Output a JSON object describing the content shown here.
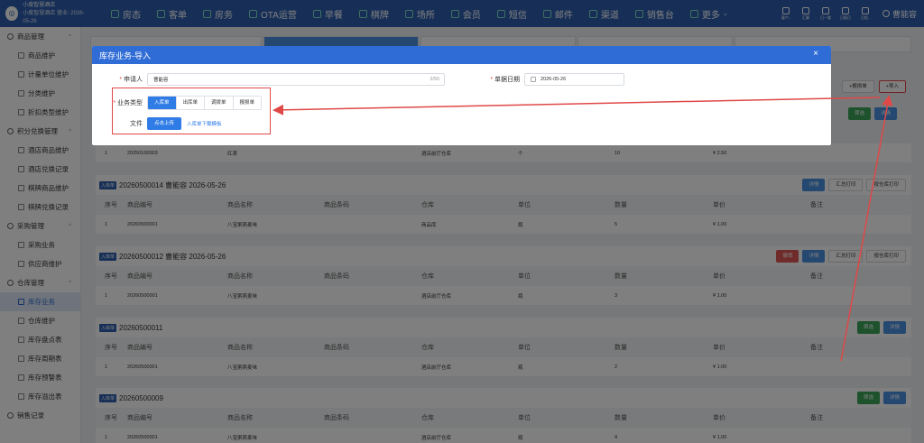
{
  "app": {
    "name": "小度智慧酒店",
    "subtitle": "小度智慧酒店 营业: 2026-05-26"
  },
  "nav": [
    "房态",
    "客单",
    "房务",
    "OTA运营",
    "早餐",
    "棋牌",
    "场所",
    "会员",
    "短信",
    "邮件",
    "渠道",
    "销售台",
    "更多"
  ],
  "nav_more_caret": "⌄",
  "tools": [
    "客户..",
    "汇算",
    "日一看",
    "日报日",
    "日程.."
  ],
  "user": "曹能容",
  "sidebar": [
    {
      "label": "商品管理",
      "type": "group",
      "caret": "^"
    },
    {
      "label": "商品维护",
      "type": "item"
    },
    {
      "label": "计量单位维护",
      "type": "item"
    },
    {
      "label": "分类维护",
      "type": "item"
    },
    {
      "label": "折扣类型维护",
      "type": "item"
    },
    {
      "label": "积分兑换管理",
      "type": "group",
      "caret": "^"
    },
    {
      "label": "酒店商品维护",
      "type": "item"
    },
    {
      "label": "酒店兑换记录",
      "type": "item"
    },
    {
      "label": "棋牌商品维护",
      "type": "item"
    },
    {
      "label": "棋牌兑换记录",
      "type": "item"
    },
    {
      "label": "采购管理",
      "type": "group",
      "caret": "^"
    },
    {
      "label": "采购业务",
      "type": "item"
    },
    {
      "label": "供应商维护",
      "type": "item"
    },
    {
      "label": "仓库管理",
      "type": "group",
      "caret": "^"
    },
    {
      "label": "库存业务",
      "type": "item",
      "active": true
    },
    {
      "label": "仓库维护",
      "type": "item"
    },
    {
      "label": "库存盘点表",
      "type": "item"
    },
    {
      "label": "库存周期表",
      "type": "item"
    },
    {
      "label": "库存预警表",
      "type": "item"
    },
    {
      "label": "库存溢出表",
      "type": "item"
    },
    {
      "label": "销售记录",
      "type": "group"
    }
  ],
  "toolbar": {
    "btn1": "报损单",
    "btn2": "导入"
  },
  "filter": {
    "btn1": "筛选",
    "btn2": "详情"
  },
  "columns": [
    "序号",
    "商品编号",
    "商品名称",
    "商品条码",
    "仓库",
    "单位",
    "数量",
    "单价",
    "备注"
  ],
  "partial_row": {
    "no": "1",
    "code": "20250100003",
    "name": "红茶",
    "barcode": "",
    "warehouse": "酒店前厅仓库",
    "unit": "个",
    "qty": "10",
    "price": "¥ 2.50",
    "note": ""
  },
  "records": [
    {
      "tag": "入库单",
      "title": "20260500014 曹能容 2026-05-26",
      "buttons": [
        {
          "label": "详情",
          "style": "blue"
        },
        {
          "label": "汇总打印",
          "style": "white"
        },
        {
          "label": "按仓库打印",
          "style": "white"
        }
      ],
      "row": {
        "no": "1",
        "code": "20260500001",
        "name": "八宝粥燕麦味",
        "barcode": "",
        "warehouse": "商品库",
        "unit": "瓶",
        "qty": "5",
        "price": "¥ 1.00",
        "note": ""
      }
    },
    {
      "tag": "入库单",
      "title": "20260500012 曹能容 2026-05-26",
      "buttons": [
        {
          "label": "撤销",
          "style": "red"
        },
        {
          "label": "详情",
          "style": "blue"
        },
        {
          "label": "汇总打印",
          "style": "white"
        },
        {
          "label": "按仓库打印",
          "style": "white"
        }
      ],
      "row": {
        "no": "1",
        "code": "20260500001",
        "name": "八宝粥燕麦味",
        "barcode": "",
        "warehouse": "酒店前厅仓库",
        "unit": "瓶",
        "qty": "3",
        "price": "¥ 1.00",
        "note": ""
      }
    },
    {
      "tag": "入库单",
      "title": "20260500011",
      "buttons": [
        {
          "label": "筛选",
          "style": "green"
        },
        {
          "label": "详情",
          "style": "blue"
        }
      ],
      "row": {
        "no": "1",
        "code": "20260500001",
        "name": "八宝粥燕麦味",
        "barcode": "",
        "warehouse": "酒店前厅仓库",
        "unit": "瓶",
        "qty": "2",
        "price": "¥ 1.00",
        "note": ""
      }
    },
    {
      "tag": "入库单",
      "title": "20260500009",
      "buttons": [
        {
          "label": "筛选",
          "style": "green"
        },
        {
          "label": "详情",
          "style": "blue"
        }
      ],
      "row": {
        "no": "1",
        "code": "20260500001",
        "name": "八宝粥燕麦味",
        "barcode": "",
        "warehouse": "酒店前厅仓库",
        "unit": "瓶",
        "qty": "4",
        "price": "¥ 1.00",
        "note": ""
      }
    }
  ],
  "modal": {
    "title": "库存业务-导入",
    "close": "×",
    "applicant_label": "申请人",
    "applicant_value": "曹能容",
    "applicant_count": "3/50",
    "date_label": "单据日期",
    "date_value": "2026-05-26",
    "type_label": "业务类型",
    "types": [
      "入库单",
      "出库单",
      "调拨单",
      "报损单"
    ],
    "type_selected": 0,
    "file_label": "文件",
    "upload_label": "点击上传",
    "template_link": "入库单下载模板"
  },
  "colors": {
    "topbar": "#2e5faf",
    "modal_header": "#2f6cd6",
    "primary": "#2f7ce6",
    "annotation": "#e04848"
  }
}
